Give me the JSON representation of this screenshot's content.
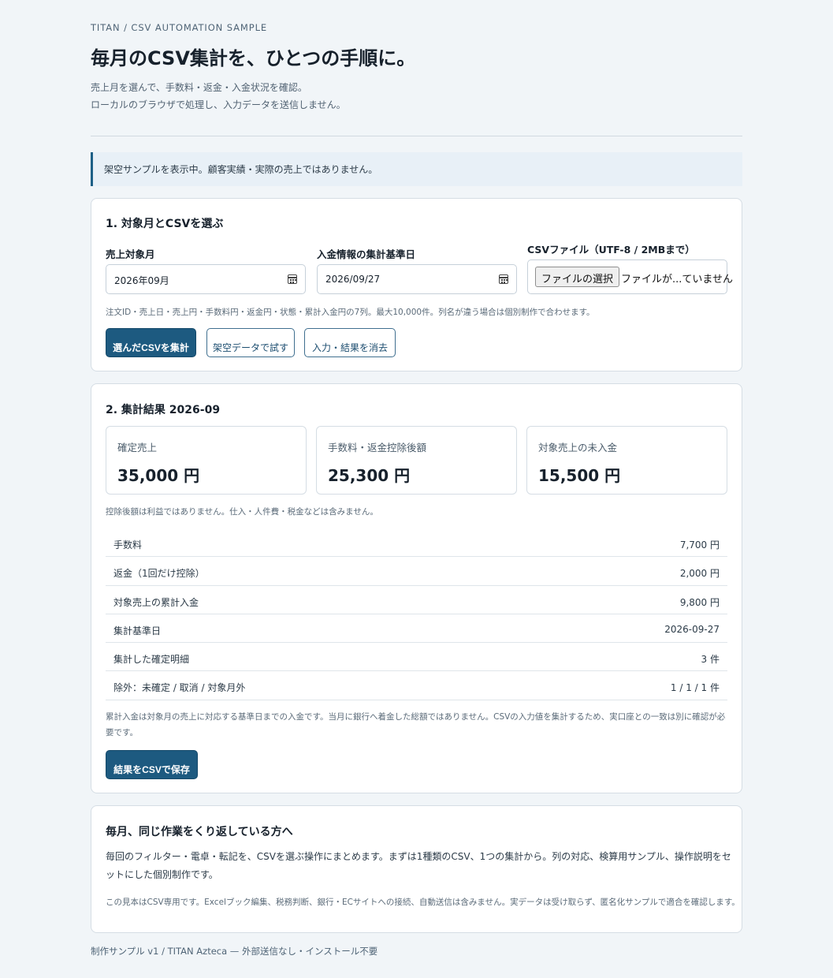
{
  "header": {
    "eyebrow": "TITAN / CSV AUTOMATION SAMPLE",
    "title": "毎月のCSV集計を、ひとつの手順に。",
    "lead_1": "売上月を選んで、手数料・返金・入金状況を確認。",
    "lead_2": "ローカルのブラウザで処理し、入力データを送信しません。"
  },
  "notice": "架空サンプルを表示中。顧客実績・実際の売上ではありません。",
  "section1": {
    "title": "1. 対象月とCSVを選ぶ",
    "month_label": "売上対象月",
    "month_value": "2026年09月",
    "date_label": "入金情報の集計基準日",
    "date_value": "2026/09/27",
    "file_label": "CSVファイル（UTF-8 / 2MBまで）",
    "file_button": "ファイルの選択",
    "file_status": "ファイルが...ていません",
    "hint": "注文ID・売上日・売上円・手数料円・返金円・状態・累計入金円の7列。最大10,000件。列名が違う場合は個別制作で合わせます。",
    "btn_aggregate": "選んだCSVを集計",
    "btn_sample": "架空データで試す",
    "btn_clear": "入力・結果を消去"
  },
  "section2": {
    "title": "2. 集計結果 2026-09",
    "kpis": [
      {
        "label": "確定売上",
        "value": "35,000 円"
      },
      {
        "label": "手数料・返金控除後額",
        "value": "25,300 円"
      },
      {
        "label": "対象売上の未入金",
        "value": "15,500 円"
      }
    ],
    "kpi_note": "控除後額は利益ではありません。仕入・人件費・税金などは含みません。",
    "rows": [
      {
        "label": "手数料",
        "value": "7,700 円"
      },
      {
        "label": "返金（1回だけ控除）",
        "value": "2,000 円"
      },
      {
        "label": "対象売上の累計入金",
        "value": "9,800 円"
      },
      {
        "label": "集計基準日",
        "value": "2026-09-27"
      },
      {
        "label": "集計した確定明細",
        "value": "3 件"
      },
      {
        "label": "除外：未確定 / 取消 / 対象月外",
        "value": "1 / 1 / 1 件"
      }
    ],
    "note": "累計入金は対象月の売上に対応する基準日までの入金です。当月に銀行へ着金した総額ではありません。CSVの入力値を集計するため、実口座との一致は別に確認が必要です。",
    "btn_save": "結果をCSVで保存"
  },
  "section3": {
    "title": "毎月、同じ作業をくり返している方へ",
    "body": "毎回のフィルター・電卓・転記を、CSVを選ぶ操作にまとめます。まずは1種類のCSV、1つの集計から。列の対応、検算用サンプル、操作説明をセットにした個別制作です。",
    "small": "この見本はCSV専用です。Excelブック編集、税務判断、銀行・ECサイトへの接続、自動送信は含みません。実データは受け取らず、匿名化サンプルで適合を確認します。"
  },
  "footer": "制作サンプル v1 / TITAN Azteca — 外部送信なし・インストール不要"
}
